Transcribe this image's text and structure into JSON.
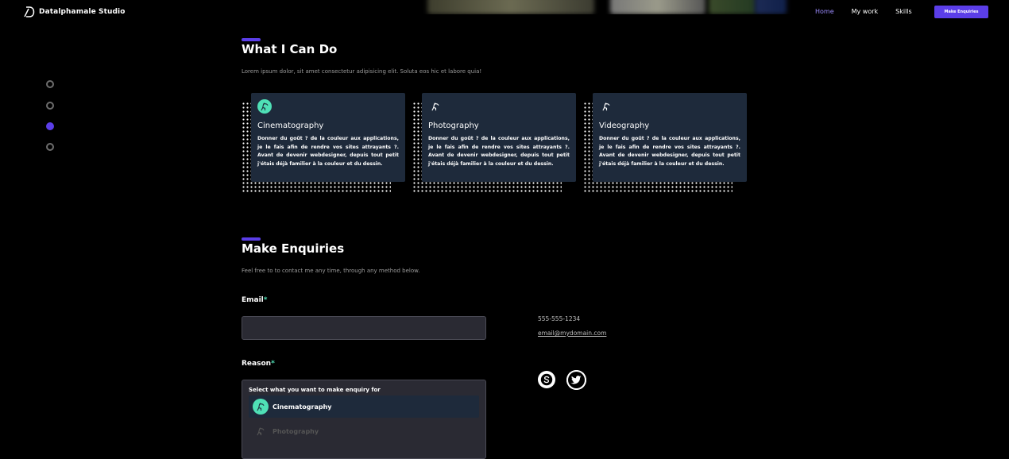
{
  "brand": {
    "name": "Datalphamale Studio",
    "logo_icon": "brand-d-icon"
  },
  "nav": {
    "links": [
      {
        "label": "Home",
        "active": true
      },
      {
        "label": "My work",
        "active": false
      },
      {
        "label": "Skills",
        "active": false
      }
    ],
    "cta_label": "Make Enquiries"
  },
  "side_dots": {
    "count": 4,
    "active_index": 2
  },
  "colors": {
    "accent": "#5b3ee8",
    "card_bg": "#1e2a3b",
    "icon_mint": "#4fe0b6",
    "background": "#000000"
  },
  "services": {
    "title": "What I Can Do",
    "subtitle": "Lorem ipsum dolor, sit amet consectetur adipisicing elit. Soluta eos hic et labore quia!",
    "cards": [
      {
        "title": "Cinematography",
        "icon": "cinematographer-icon",
        "text": "Donner du goût ? de la couleur aux applications, je le fais afin de rendre vos sites attrayants ?. Avant de devenir webdesigner, depuis tout petit j'étais déjà familier à la couleur et du dessin."
      },
      {
        "title": "Photography",
        "icon": "photographer-icon",
        "text": "Donner du goût ? de la couleur aux applications, je le fais afin de rendre vos sites attrayants ?. Avant de devenir webdesigner, depuis tout petit j'étais déjà familier à la couleur et du dessin."
      },
      {
        "title": "Videography",
        "icon": "videographer-icon",
        "text": "Donner du goût ? de la couleur aux applications, je le fais afin de rendre vos sites attrayants ?. Avant de devenir webdesigner, depuis tout petit j'étais déjà familier à la couleur et du dessin."
      }
    ]
  },
  "enquiries": {
    "title": "Make Enquiries",
    "subtitle": "Feel free to to contact me any time, through any method below.",
    "email_label": "Email",
    "reason_label": "Reason",
    "required_mark": "*",
    "email_value": "",
    "reason_prompt": "Select what you want to make enquiry for",
    "options": [
      {
        "label": "Cinematography",
        "selected": true,
        "icon": "cinematographer-icon"
      },
      {
        "label": "Photography",
        "selected": false,
        "icon": "photographer-icon"
      }
    ]
  },
  "contact": {
    "phone": "555-555-1234",
    "email": "email@mydomain.com",
    "socials": [
      {
        "icon": "skype-icon"
      },
      {
        "icon": "twitter-icon"
      }
    ]
  }
}
